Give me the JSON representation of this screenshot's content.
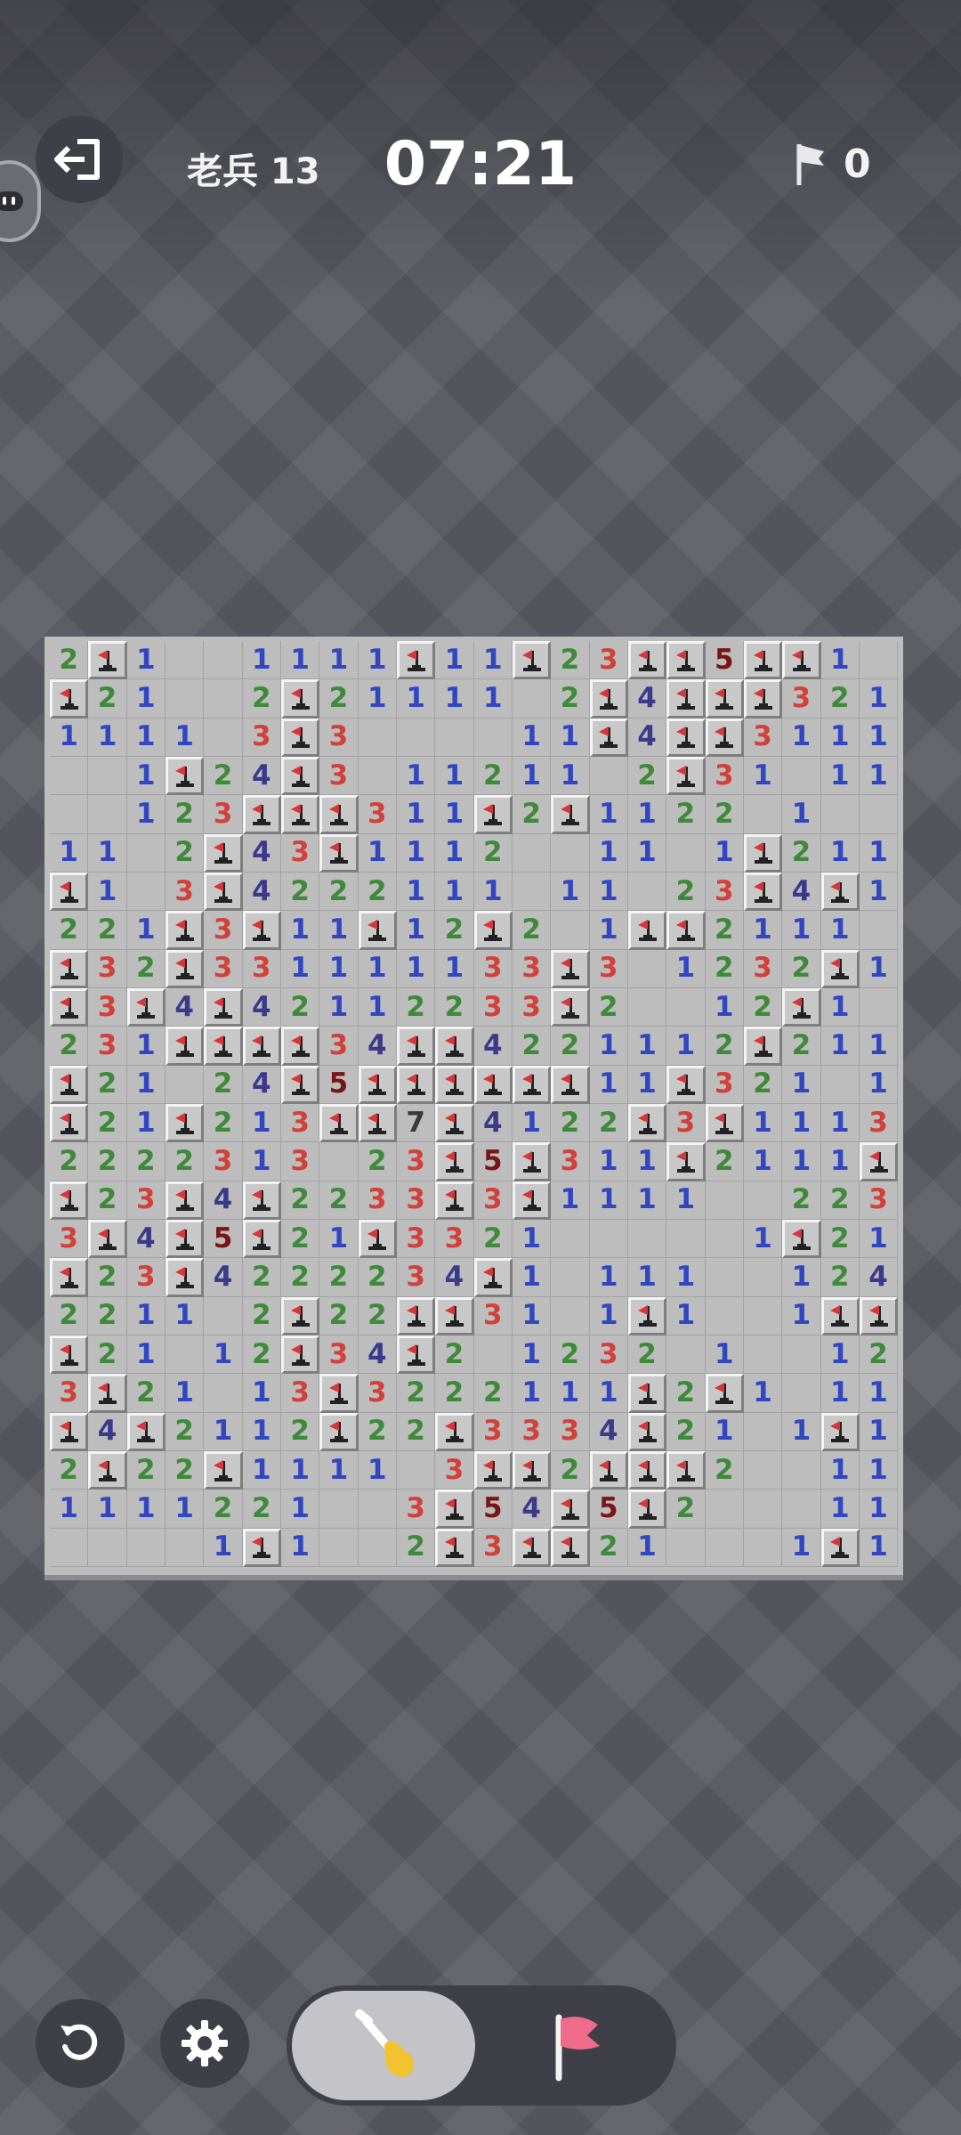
{
  "header": {
    "level_label": "老兵 13",
    "timer": "07:21",
    "flag_count": "0",
    "exit_icon": "exit-icon",
    "flag_icon": "flag-icon"
  },
  "colors": {
    "1": "#3147c2",
    "2": "#3f8a3a",
    "3": "#d2403a",
    "4": "#3b3a8a",
    "5": "#7a1515",
    "7": "#3a3a3a",
    "flag": "#d83636",
    "mine": "#222222"
  },
  "board": {
    "cols": 22,
    "rows": [
      "2F1..1111F11F23FF5FF1..",
      "F21..2F21111.2F4FFF3211",
      "1111.3F3....11F4FF3111F1",
      "..1F24F3.11211.2F31.111",
      "..123FFF311F2F1122.1...",
      "11.2F43F1112..11.1F21111",
      "F1.3F4222111.11.23F4F11F",
      "221F3F11F12F2.1FF2111",
      "F32F331111133F3.1232F1..",
      "F3F4F42112233F2..12F1...",
      "231FFFF34FF4221112F2111",
      "F21.24F5FFFFFF11F321.1F",
      "F21F213FF7F4122F3F1113 2",
      "2222313.23F5F311F2111F2F",
      "F23F4F2233F3F1111..2231",
      "3F4F5F21F3321.....1F21",
      "F23F4222234F1.111..124#",
      "2211.2F22FF31.1F1..1FF",
      "F21.12F34F2.1232 1..122",
      "3F21.13F3222111F2F1.111",
      "F4F2112F22F3334F21.1F1",
      "2F22F1111.3FF2FFF2..111",
      "1111221..3F54F5F2...111",
      "....1F1..2F3FF21...1F1"
    ]
  }
}
